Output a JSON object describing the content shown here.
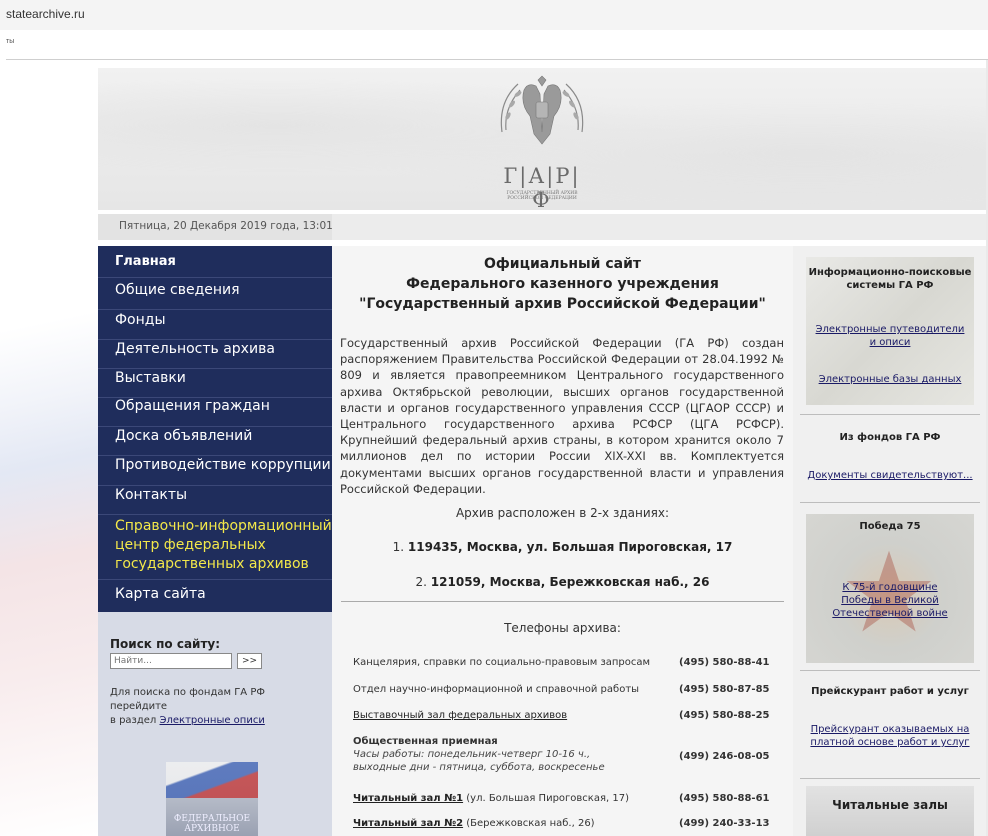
{
  "browser": {
    "url": "statearchive.ru",
    "subtitle": "ты"
  },
  "header": {
    "logo_letters": "Г|А|Р|Ф",
    "logo_sub_line1": "ГОСУДАРСТВЕННЫЙ АРХИВ",
    "logo_sub_line2": "РОССИЙСКОЙ ФЕДЕРАЦИИ"
  },
  "datebar": {
    "date": "Пятница, 20 Декабря 2019 года,  13:01"
  },
  "nav": {
    "items": [
      {
        "label": "Главная"
      },
      {
        "label": "Общие сведения"
      },
      {
        "label": "Фонды"
      },
      {
        "label": "Деятельность архива"
      },
      {
        "label": "Выставки"
      },
      {
        "label": "Обращения граждан"
      },
      {
        "label": "Доска объявлений"
      },
      {
        "label": "Противодействие коррупции"
      },
      {
        "label": "Контакты"
      },
      {
        "label_line1": "Справочно-информационный",
        "label_line2": "центр федеральных",
        "label_line3": "государственных архивов"
      },
      {
        "label": "Карта сайта"
      }
    ]
  },
  "search": {
    "title": "Поиск по сайту:",
    "placeholder": "Найти...",
    "button": ">>",
    "hint_line1": "Для поиска по фондам ГА РФ перейдите",
    "hint_prefix": "в раздел ",
    "hint_link": "Электронные описи"
  },
  "fed_logo": {
    "line1": "ФЕДЕРАЛЬНОЕ",
    "line2": "АРХИВНОЕ"
  },
  "main": {
    "title_line1": "Официальный сайт",
    "title_line2": "Федерального казенного учреждения",
    "title_line3": "\"Государственный архив Российской Федерации\"",
    "intro": "Государственный архив Российской Федерации (ГА РФ) создан распоряжением Правительства Российской Федерации от 28.04.1992 № 809 и является правопреемником Центрального государственного архива Октябрьской революции, высших органов государственной власти и органов государственного управления СССР (ЦГАОР СССР) и Центрального государственного архива РСФСР (ЦГА РСФСР). Крупнейший федеральный архив страны, в котором хранится около 7 миллионов дел по истории России XIX-XXI вв. Комплектуется документами высших органов государственной власти и управления Российской Федерации.",
    "buildings_intro": "Архив расположен в 2-х зданиях:",
    "building1_num": "1. ",
    "building1": "119435, Москва, ул. Большая Пироговская, 17",
    "building2_num": "2. ",
    "building2": "121059, Москва, Бережковская наб., 26",
    "phones_title": "Телефоны архива:",
    "phones": [
      {
        "label": "Канцелярия, справки по социально-правовым запросам",
        "number": "(495) 580-88-41"
      },
      {
        "label": "Отдел научно-информационной и справочной работы",
        "number": "(495) 580-87-85"
      },
      {
        "label": "Выставочный зал федеральных архивов",
        "number": "(495) 580-88-25"
      },
      {
        "label": "Общественная приемная",
        "note_line1": "Часы работы: понедельник-четверг 10-16 ч.,",
        "note_line2": "выходные дни - пятница, суббота, воскресенье",
        "number": "(499) 246-08-05"
      },
      {
        "label": "Читальный зал №1",
        "extra": " (ул. Большая Пироговская, 17)",
        "number": "(495) 580-88-61"
      },
      {
        "label": "Читальный зал №2",
        "extra": " (Бережковская наб., 26)",
        "number": "(499) 240-33-13"
      }
    ]
  },
  "right": {
    "box1_title_line1": "Информационно-поисковые",
    "box1_title_line2": "системы ГА РФ",
    "box1_link1_line1": "Электронные путеводители",
    "box1_link1_line2": "и описи",
    "box1_link2": "Электронные базы данных",
    "box2_title": "Из фондов ГА РФ",
    "box2_link": "Документы свидетельствуют...",
    "box3_title": "Победа 75",
    "box3_link_line1": "К 75-й годовщине",
    "box3_link_line2": "Победы в Великой",
    "box3_link_line3": "Отечественной войне",
    "box4_title": "Прейскурант работ и услуг",
    "box4_link_line1": "Прейскурант оказываемых на",
    "box4_link_line2": "платной основе работ и услуг",
    "box5_title": "Читальные залы"
  }
}
